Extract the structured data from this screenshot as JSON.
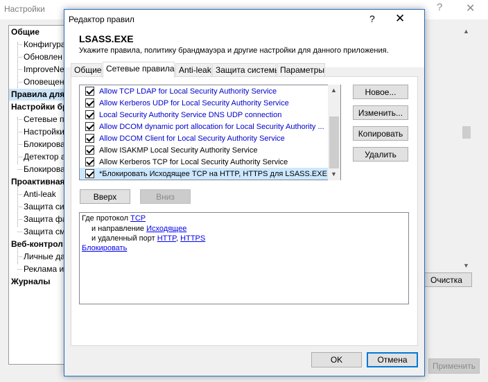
{
  "background": {
    "title": "Настройки",
    "help_glyph": "?",
    "close_glyph": "✕",
    "tree": [
      {
        "label": "Общие",
        "bold": true
      },
      {
        "label": "Конфигура",
        "bold": false
      },
      {
        "label": "Обновлен",
        "bold": false
      },
      {
        "label": "ImproveNe",
        "bold": false
      },
      {
        "label": "Оповещен",
        "bold": false
      },
      {
        "label": "Правила для",
        "bold": true,
        "selected": true
      },
      {
        "label": "Настройки бр",
        "bold": true
      },
      {
        "label": "Сетевые п",
        "bold": false
      },
      {
        "label": "Настройки",
        "bold": false
      },
      {
        "label": "Блокирова",
        "bold": false
      },
      {
        "label": "Детектор а",
        "bold": false
      },
      {
        "label": "Блокирова",
        "bold": false
      },
      {
        "label": "Проактивная",
        "bold": true
      },
      {
        "label": "Anti-leak",
        "bold": false
      },
      {
        "label": "Защита си",
        "bold": false
      },
      {
        "label": "Защита фа",
        "bold": false
      },
      {
        "label": "Защита см",
        "bold": false
      },
      {
        "label": "Веб-контрол",
        "bold": true
      },
      {
        "label": "Личные да",
        "bold": false
      },
      {
        "label": "Реклама и",
        "bold": false
      },
      {
        "label": "Журналы",
        "bold": true
      }
    ],
    "clear_button": "Очистка",
    "apply_button": "Применить"
  },
  "dialog": {
    "title": "Редактор правил",
    "help_glyph": "?",
    "close_glyph": "✕",
    "app_name": "LSASS.EXE",
    "subtitle": "Укажите правила, политику брандмауэра и другие настройки для данного приложения.",
    "tabs": [
      {
        "label": "Общие",
        "active": false
      },
      {
        "label": "Сетевые правила",
        "active": true
      },
      {
        "label": "Anti-leak",
        "active": false
      },
      {
        "label": "Защита системы",
        "active": false
      },
      {
        "label": "Параметры",
        "active": false
      }
    ],
    "rules": [
      {
        "label": "Allow TCP LDAP for Local Security Authority Service",
        "checked": true,
        "color": "#0000cc"
      },
      {
        "label": "Allow Kerberos UDP for Local Security Authority Service",
        "checked": true,
        "color": "#0000cc"
      },
      {
        "label": "Local Security Authority Service DNS UDP connection",
        "checked": true,
        "color": "#0000cc"
      },
      {
        "label": "Allow DCOM dynamic port allocation for Local Security Authority ...",
        "checked": true,
        "color": "#0000cc"
      },
      {
        "label": "Allow DCOM Client for Local Security Authority Service",
        "checked": true,
        "color": "#0000cc"
      },
      {
        "label": "Allow ISAKMP Local Security Authority Service",
        "checked": true,
        "color": "#000000"
      },
      {
        "label": "Allow Kerberos TCP for Local Security Authority Service",
        "checked": true,
        "color": "#000000"
      },
      {
        "label": "*Блокировать Исходящее TCP на HTTP, HTTPS для LSASS.EXE",
        "checked": true,
        "color": "#000000",
        "selected": true
      }
    ],
    "side_buttons": {
      "new": "Новое...",
      "edit": "Изменить...",
      "copy": "Копировать",
      "delete": "Удалить"
    },
    "move_buttons": {
      "up": "Вверх",
      "down": "Вниз"
    },
    "condition": {
      "protocol_prefix": "Где протокол",
      "protocol": "TCP",
      "direction_prefix": "и направление",
      "direction": "Исходящее",
      "port_prefix": "и удаленный порт",
      "port_1": "HTTP",
      "port_sep": ",",
      "port_2": "HTTPS",
      "action": "Блокировать"
    },
    "ok_button": "OK",
    "cancel_button": "Отмена"
  }
}
